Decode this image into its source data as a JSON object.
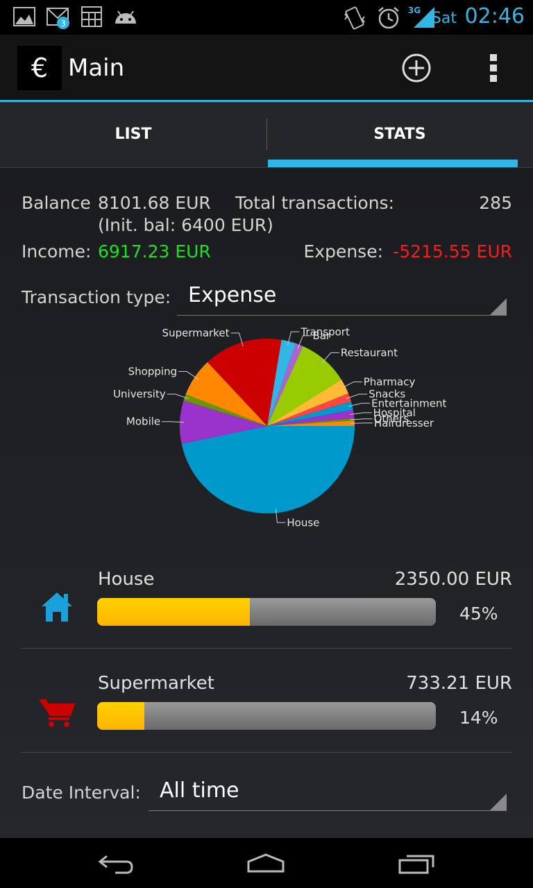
{
  "status_bar": {
    "day": "Sat",
    "time": "02:46",
    "network": "3G",
    "gmail_count": "3",
    "icons": [
      "gallery-icon",
      "gmail-icon",
      "calculator-icon",
      "android-icon",
      "vibrate-icon",
      "alarm-icon",
      "signal-icon"
    ]
  },
  "action_bar": {
    "app_icon": "€",
    "title": "Main",
    "actions": [
      "add-icon",
      "overflow-menu-icon"
    ]
  },
  "tabs": [
    {
      "label": "LIST",
      "selected": false
    },
    {
      "label": "STATS",
      "selected": true
    }
  ],
  "summary": {
    "balance_label": "Balance",
    "balance_value": "8101.68 EUR",
    "init_balance": "(Init. bal: 6400 EUR)",
    "total_label": "Total transactions:",
    "total_value": "285",
    "income_label": "Income:",
    "income_value": "6917.23 EUR",
    "expense_label": "Expense:",
    "expense_value": "-5215.55 EUR"
  },
  "transaction_type": {
    "label": "Transaction type:",
    "value": "Expense"
  },
  "chart_data": {
    "type": "pie",
    "labels": [
      "House",
      "Mobile",
      "University",
      "Shopping",
      "Supermarket",
      "Transport",
      "Bar",
      "Restaurant",
      "Pharmacy",
      "Snacks",
      "Entertainment",
      "Hospital",
      "Others",
      "Hairdresser"
    ],
    "values": [
      2350.0,
      402,
      61,
      358,
      733.21,
      135,
      70,
      473,
      142,
      78,
      78,
      80,
      22,
      48
    ],
    "colors": [
      "#0099cc",
      "#9933cc",
      "#669900",
      "#ff8800",
      "#cc0000",
      "#33b5e5",
      "#aa66cc",
      "#99cc00",
      "#ffbb33",
      "#ff4444",
      "#0099cc",
      "#9933cc",
      "#669900",
      "#ff8800"
    ]
  },
  "categories": [
    {
      "name": "House",
      "amount": "2350.00 EUR",
      "percent": "45%",
      "fraction": 0.45,
      "icon": "house-icon",
      "icon_color": "#1aa0db"
    },
    {
      "name": "Supermarket",
      "amount": "733.21 EUR",
      "percent": "14%",
      "fraction": 0.14,
      "icon": "shopping-cart-icon",
      "icon_color": "#cc0000"
    }
  ],
  "date_interval": {
    "label": "Date Interval:",
    "value": "All time"
  },
  "nav_bar": [
    "back-icon",
    "home-icon",
    "recents-icon"
  ]
}
